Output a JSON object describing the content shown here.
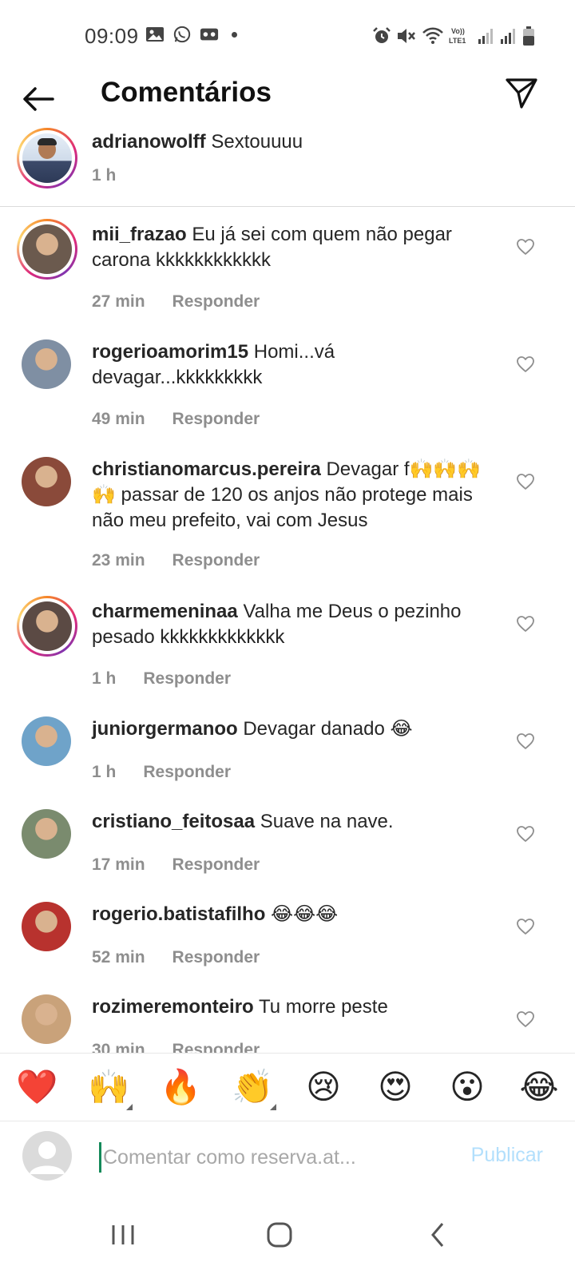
{
  "status_bar": {
    "time": "09:09",
    "left_icons": [
      "image-icon",
      "whatsapp-icon",
      "voicemail-icon",
      "dot-icon"
    ],
    "right_icons": [
      "alarm-icon",
      "mute-icon",
      "wifi-icon",
      "volte-icon",
      "signal-icon",
      "signal-icon",
      "battery-icon"
    ],
    "volte_label": "Vo)) LTE1"
  },
  "header": {
    "title": "Comentários"
  },
  "caption": {
    "username": "adrianowolff",
    "text": "Sextouuuu",
    "time": "1 h"
  },
  "reply_label": "Responder",
  "comments": [
    {
      "username": "mii_frazao",
      "text": "Eu já sei com quem não pegar carona kkkkkkkkkkkk",
      "time": "27 min",
      "avatar_color": "#6b5a4e",
      "story_ring": true
    },
    {
      "username": "rogerioamorim15",
      "text": "Homi...vá devagar...kkkkkkkkk",
      "time": "49 min",
      "avatar_color": "#7f8fa3",
      "story_ring": false
    },
    {
      "username": "christianomarcus.pereira",
      "text": "Devagar f🙌🙌🙌🙌 passar de 120 os anjos não protege mais não meu prefeito, vai com Jesus",
      "time": "23 min",
      "avatar_color": "#8a4a3a",
      "story_ring": false
    },
    {
      "username": "charmemeninaa",
      "text": "Valha me Deus o pezinho pesado kkkkkkkkkkkkk",
      "time": "1 h",
      "avatar_color": "#5b4a44",
      "story_ring": true
    },
    {
      "username": "juniorgermanoo",
      "text": "Devagar danado 😂",
      "time": "1 h",
      "avatar_color": "#6fa3c9",
      "story_ring": false
    },
    {
      "username": "cristiano_feitosaa",
      "text": "Suave na nave.",
      "time": "17 min",
      "avatar_color": "#7a8b6e",
      "story_ring": false
    },
    {
      "username": "rogerio.batistafilho",
      "text": "😂😂😂",
      "time": "52 min",
      "avatar_color": "#b8322e",
      "story_ring": false
    },
    {
      "username": "rozimeremonteiro",
      "text": "Tu morre peste",
      "time": "30 min",
      "avatar_color": "#c9a27a",
      "story_ring": false
    }
  ],
  "emoji_bar": [
    "❤️",
    "🙌",
    "🔥",
    "👏",
    "😢",
    "😍",
    "😮",
    "😂"
  ],
  "input": {
    "placeholder": "Comentar como reserva.at...",
    "publish_label": "Publicar"
  },
  "colors": {
    "text": "#262626",
    "meta": "#8e8e8e",
    "publish_disabled": "#b2dffc"
  }
}
